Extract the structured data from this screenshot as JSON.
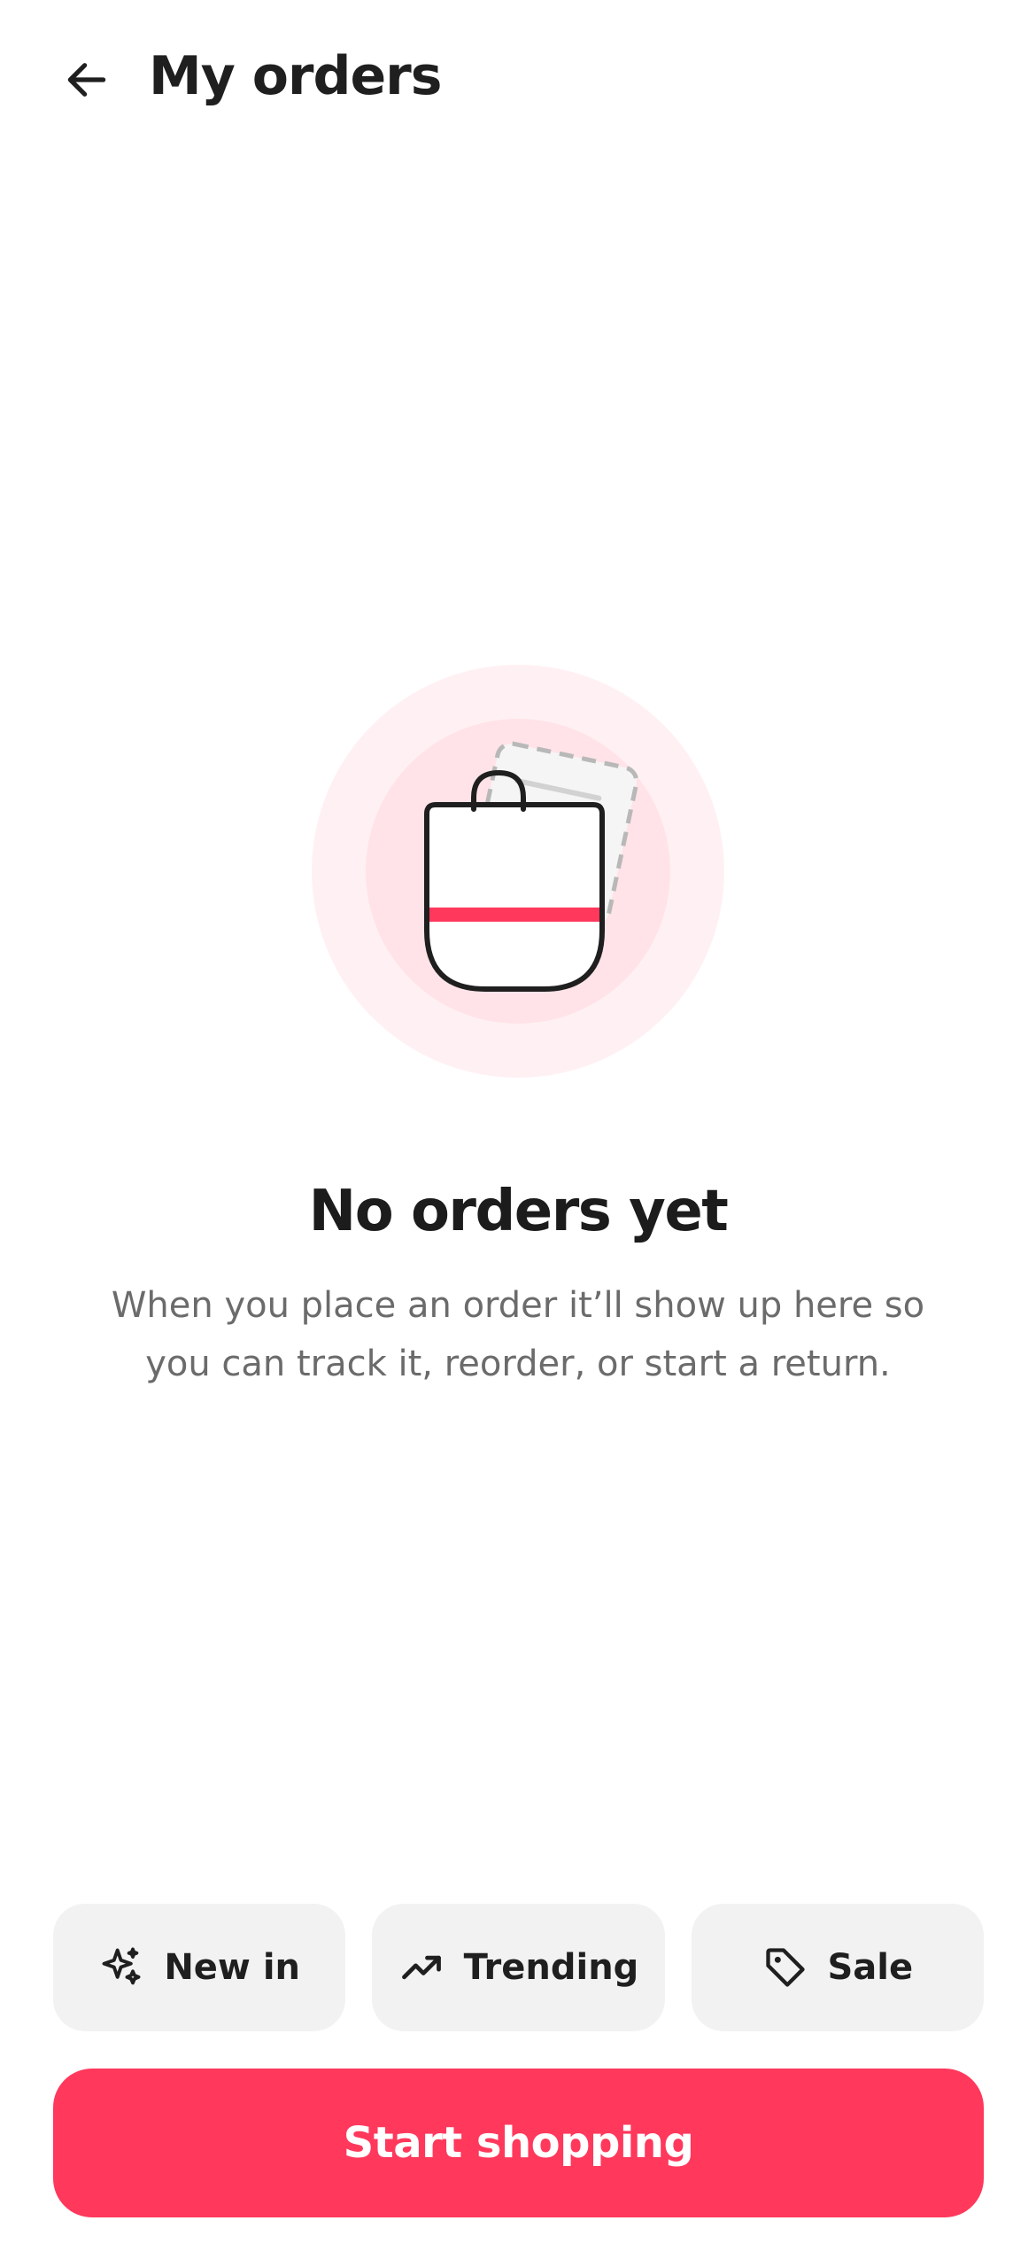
{
  "header": {
    "title": "My orders",
    "back_icon": "arrow-left-icon"
  },
  "illustration": {
    "icon": "shopping-bag-icon",
    "accent_color": "#ff385c",
    "halo_outer_color": "#fff1f3",
    "halo_inner_color": "#ffe3e8"
  },
  "empty_state": {
    "title": "No orders yet",
    "line1": "When you place an order it’ll show up here so",
    "line2": "you can track it, reorder, or start a return."
  },
  "chips": [
    {
      "label": "New in",
      "icon": "sparkles-icon"
    },
    {
      "label": "Trending",
      "icon": "trending-up-icon"
    },
    {
      "label": "Sale",
      "icon": "tag-icon"
    }
  ],
  "cta": {
    "label": "Start shopping",
    "color": "#ff385c"
  }
}
